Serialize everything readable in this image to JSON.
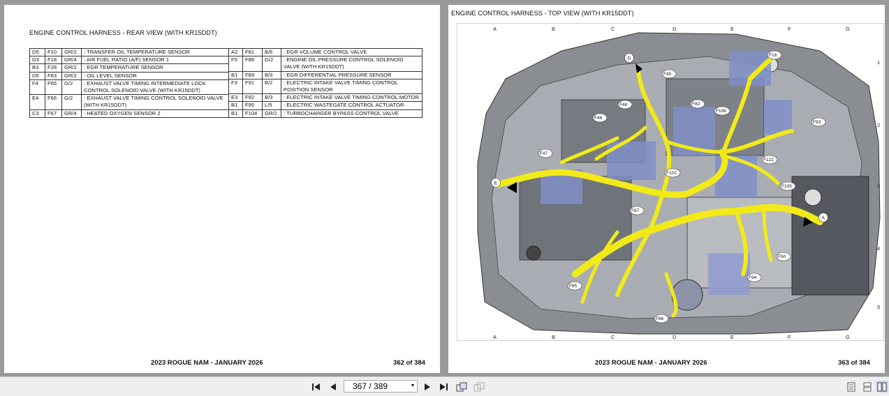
{
  "left_page": {
    "title": "ENGINE CONTROL HARNESS - REAR VIEW (WITH KR15DDT)",
    "connectors_left": [
      {
        "grid": "D5",
        "conn": "F10",
        "color": "GR/2",
        "desc": ": TRANSFER OIL TEMPERATURE SENSOR"
      },
      {
        "grid": "D3",
        "conn": "F18",
        "color": "GR/4",
        "desc": ": AIR FUEL RATIO (A/F) SENSOR 1"
      },
      {
        "grid": "B3",
        "conn": "F28",
        "color": "GR/2",
        "desc": ": EGR TEMPERATURE SENSOR"
      },
      {
        "grid": "D5",
        "conn": "F63",
        "color": "GR/2",
        "desc": ": OIL LEVEL SENSOR"
      },
      {
        "grid": "F4",
        "conn": "F65",
        "color": "G/2",
        "desc": ": EXHAUST VALVE TIMING INTERMEDIATE LOCK CONTROL SOLENOID VALVE (WITH KR15DDT)"
      },
      {
        "grid": "E4",
        "conn": "F66",
        "color": "G/2",
        "desc": ": EXHAUST VALVE TIMING CONTROL SOLENOID VALVE (WITH KR15DDT)"
      },
      {
        "grid": "C3",
        "conn": "F67",
        "color": "GR/4",
        "desc": ": HEATED OXYGEN SENSOR 2"
      }
    ],
    "connectors_right": [
      {
        "grid": "A2",
        "conn": "F81",
        "color": "B/6",
        "desc": ": EGR VOLUME CONTROL VALVE"
      },
      {
        "grid": "F5",
        "conn": "F88",
        "color": "G/2",
        "desc": ": ENGINE OIL PRESSURE CONTROL SOLENOID VALVE (WITH KR15DDT)"
      },
      {
        "grid": "B1",
        "conn": "F89",
        "color": "B/3",
        "desc": ": EGR DIFFERENTIAL PRESSURE SENSOR"
      },
      {
        "grid": "F3",
        "conn": "F91",
        "color": "B/2",
        "desc": ": ELECTRIC INTAKE VALVE TIMING CONTROL POSITION SENSOR"
      },
      {
        "grid": "E3",
        "conn": "F92",
        "color": "B/3",
        "desc": ": ELECTRIC INTAKE VALVE TIMING CONTROL MOTOR"
      },
      {
        "grid": "B1",
        "conn": "F95",
        "color": "L/5",
        "desc": ": ELECTRIC WASTEGATE CONTROL ACTUATOR"
      },
      {
        "grid": "B1",
        "conn": "F104",
        "color": "GR/2",
        "desc": ": TURBOCHARGER BYPASS CONTROL VALVE"
      }
    ],
    "footer": "2023 ROGUE NAM - JANUARY 2026",
    "page_number": "362 of 384"
  },
  "right_page": {
    "title": "ENGINE CONTROL HARNESS - TOP VIEW (WITH KR15DDT)",
    "columns": [
      "A",
      "B",
      "C",
      "D",
      "E",
      "F",
      "G"
    ],
    "rows": [
      "1",
      "2",
      "3",
      "4",
      "5"
    ],
    "callouts": [
      "F16",
      "F45",
      "F82",
      "F106",
      "F93",
      "F48",
      "F46",
      "F47",
      "F122",
      "F102",
      "F105",
      "F87",
      "F50",
      "F94",
      "F85",
      "F86"
    ],
    "arrows": [
      "D",
      "E",
      "A"
    ],
    "footer": "2023 ROGUE NAM - JANUARY 2026",
    "page_number": "363 of 384"
  },
  "toolbar": {
    "page_display": "367 / 389",
    "buttons": [
      "first-page-icon",
      "prev-page-icon",
      "next-page-icon",
      "last-page-icon",
      "rotate-icon",
      "rotate-alt-icon",
      "single-page-icon",
      "continuous-icon",
      "two-page-icon"
    ]
  },
  "colors": {
    "harness": "#f2ea18",
    "background": "#9a9a9a",
    "toolbar": "#efefef"
  }
}
